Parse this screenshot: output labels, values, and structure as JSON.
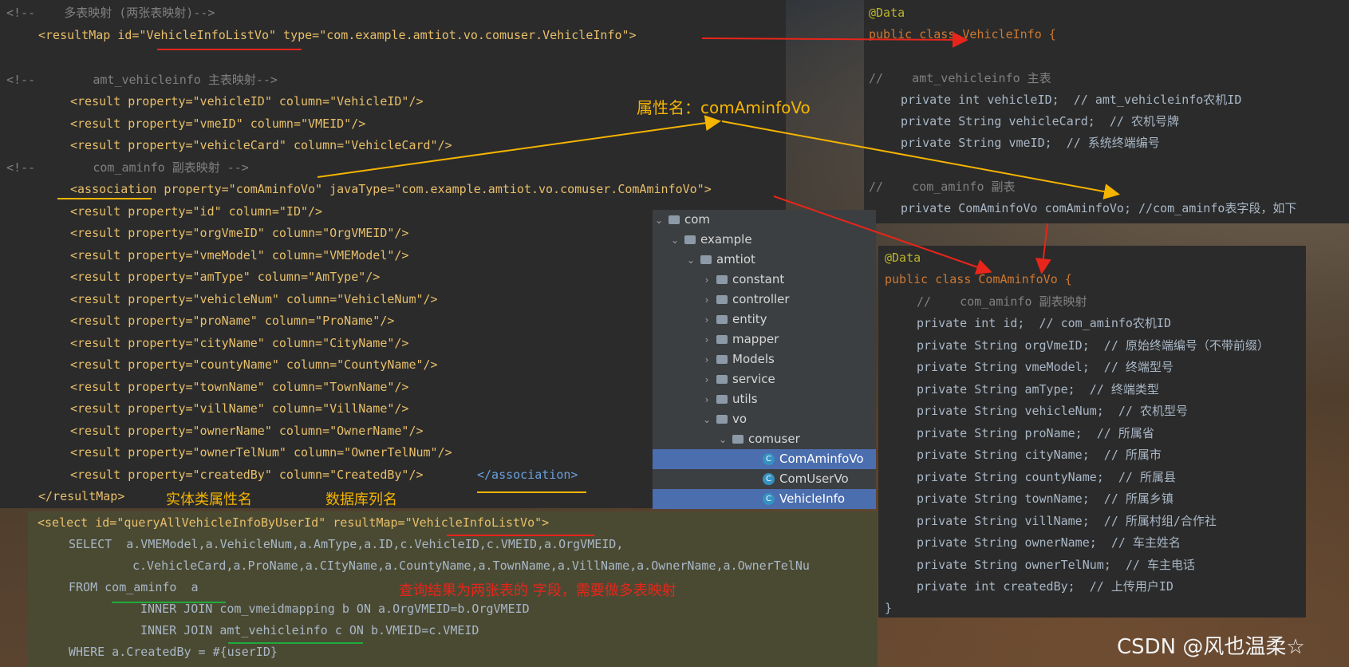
{
  "xml": {
    "lines": [
      "<!--    多表映射 (两张表映射)-->",
      "<resultMap id=\"VehicleInfoListVo\" type=\"com.example.amtiot.vo.comuser.VehicleInfo\">",
      "<!--        amt_vehicleinfo 主表映射-->",
      "<result property=\"vehicleID\" column=\"VehicleID\"/>",
      "<result property=\"vmeID\" column=\"VMEID\"/>",
      "<result property=\"vehicleCard\" column=\"VehicleCard\"/>",
      "<!--        com_aminfo 副表映射 -->",
      "<association property=\"comAminfoVo\" javaType=\"com.example.amtiot.vo.comuser.ComAminfoVo\">",
      "<result property=\"id\" column=\"ID\"/>",
      "<result property=\"orgVmeID\" column=\"OrgVMEID\"/>",
      "<result property=\"vmeModel\" column=\"VMEModel\"/>",
      "<result property=\"amType\" column=\"AmType\"/>",
      "<result property=\"vehicleNum\" column=\"VehicleNum\"/>",
      "<result property=\"proName\" column=\"ProName\"/>",
      "<result property=\"cityName\" column=\"CityName\"/>",
      "<result property=\"countyName\" column=\"CountyName\"/>",
      "<result property=\"townName\" column=\"TownName\"/>",
      "<result property=\"villName\" column=\"VillName\"/>",
      "<result property=\"ownerName\" column=\"OwnerName\"/>",
      "<result property=\"ownerTelNum\" column=\"OwnerTelNum\"/>",
      "<result property=\"createdBy\" column=\"CreatedBy\"/>",
      "</association>",
      "</resultMap>"
    ]
  },
  "sql": {
    "lines": [
      "<select id=\"queryAllVehicleInfoByUserId\" resultMap=\"VehicleInfoListVo\">",
      "SELECT  a.VMEModel,a.VehicleNum,a.AmType,a.ID,c.VehicleID,c.VMEID,a.OrgVMEID,",
      "c.VehicleCard,a.ProName,a.CItyName,a.CountyName,a.TownName,a.VillName,a.OwnerName,a.OwnerTelNu",
      "FROM com_aminfo  a",
      "INNER JOIN com_vmeidmapping b ON a.OrgVMEID=b.OrgVMEID",
      "INNER JOIN amt_vehicleinfo c ON b.VMEID=c.VMEID",
      "WHERE a.CreatedBy = #{userID}"
    ]
  },
  "vehicle_info": {
    "lines": [
      "@Data",
      "public class VehicleInfo {",
      "//    amt_vehicleinfo 主表",
      "private int vehicleID;  // amt_vehicleinfo农机ID",
      "private String vehicleCard;  // 农机号牌",
      "private String vmeID;  // 系统终端编号",
      "//    com_aminfo 副表",
      "private ComAminfoVo comAminfoVo; //com_aminfo表字段，如下"
    ]
  },
  "com_aminfo_vo": {
    "lines": [
      "@Data",
      "public class ComAminfoVo {",
      "//    com_aminfo 副表映射",
      "private int id;  // com_aminfo农机ID",
      "private String orgVmeID;  // 原始终端编号（不带前缀）",
      "private String vmeModel;  // 终端型号",
      "private String amType;  // 终端类型",
      "private String vehicleNum;  // 农机型号",
      "private String proName;  // 所属省",
      "private String cityName;  // 所属市",
      "private String countyName;  // 所属县",
      "private String townName;  // 所属乡镇",
      "private String villName;  // 所属村组/合作社",
      "private String ownerName;  // 车主姓名",
      "private String ownerTelNum;  // 车主电话",
      "private int createdBy;  // 上传用户ID",
      "}"
    ]
  },
  "project_tree": {
    "items": [
      {
        "label": "com",
        "kind": "folder",
        "expanded": true
      },
      {
        "label": "example",
        "kind": "folder",
        "expanded": true
      },
      {
        "label": "amtiot",
        "kind": "folder",
        "expanded": true
      },
      {
        "label": "constant",
        "kind": "folder",
        "expanded": false
      },
      {
        "label": "controller",
        "kind": "folder",
        "expanded": false
      },
      {
        "label": "entity",
        "kind": "folder",
        "expanded": false
      },
      {
        "label": "mapper",
        "kind": "folder",
        "expanded": false
      },
      {
        "label": "Models",
        "kind": "folder",
        "expanded": false
      },
      {
        "label": "service",
        "kind": "folder",
        "expanded": false
      },
      {
        "label": "utils",
        "kind": "folder",
        "expanded": false
      },
      {
        "label": "vo",
        "kind": "folder",
        "expanded": true
      },
      {
        "label": "comuser",
        "kind": "folder",
        "expanded": true
      },
      {
        "label": "ComAminfoVo",
        "kind": "class",
        "selected": true
      },
      {
        "label": "ComUserVo",
        "kind": "class",
        "selected": false
      },
      {
        "label": "VehicleInfo",
        "kind": "class",
        "selected": true
      }
    ]
  },
  "annotations": {
    "property_name": "属性名：comAminfoVo",
    "entity_field_name": "实体类属性名",
    "db_column_name": "数据库列名",
    "query_result_note": "查询结果为两张表的 字段，需要做多表映射",
    "watermark": "CSDN @风也温柔☆"
  },
  "colors": {
    "editor_bg": "#2b2b2b",
    "sql_bg": "#4a4a33",
    "arrow_red": "#e8251a",
    "arrow_yellow": "#f5b400",
    "underline_green": "#1faa3a"
  }
}
